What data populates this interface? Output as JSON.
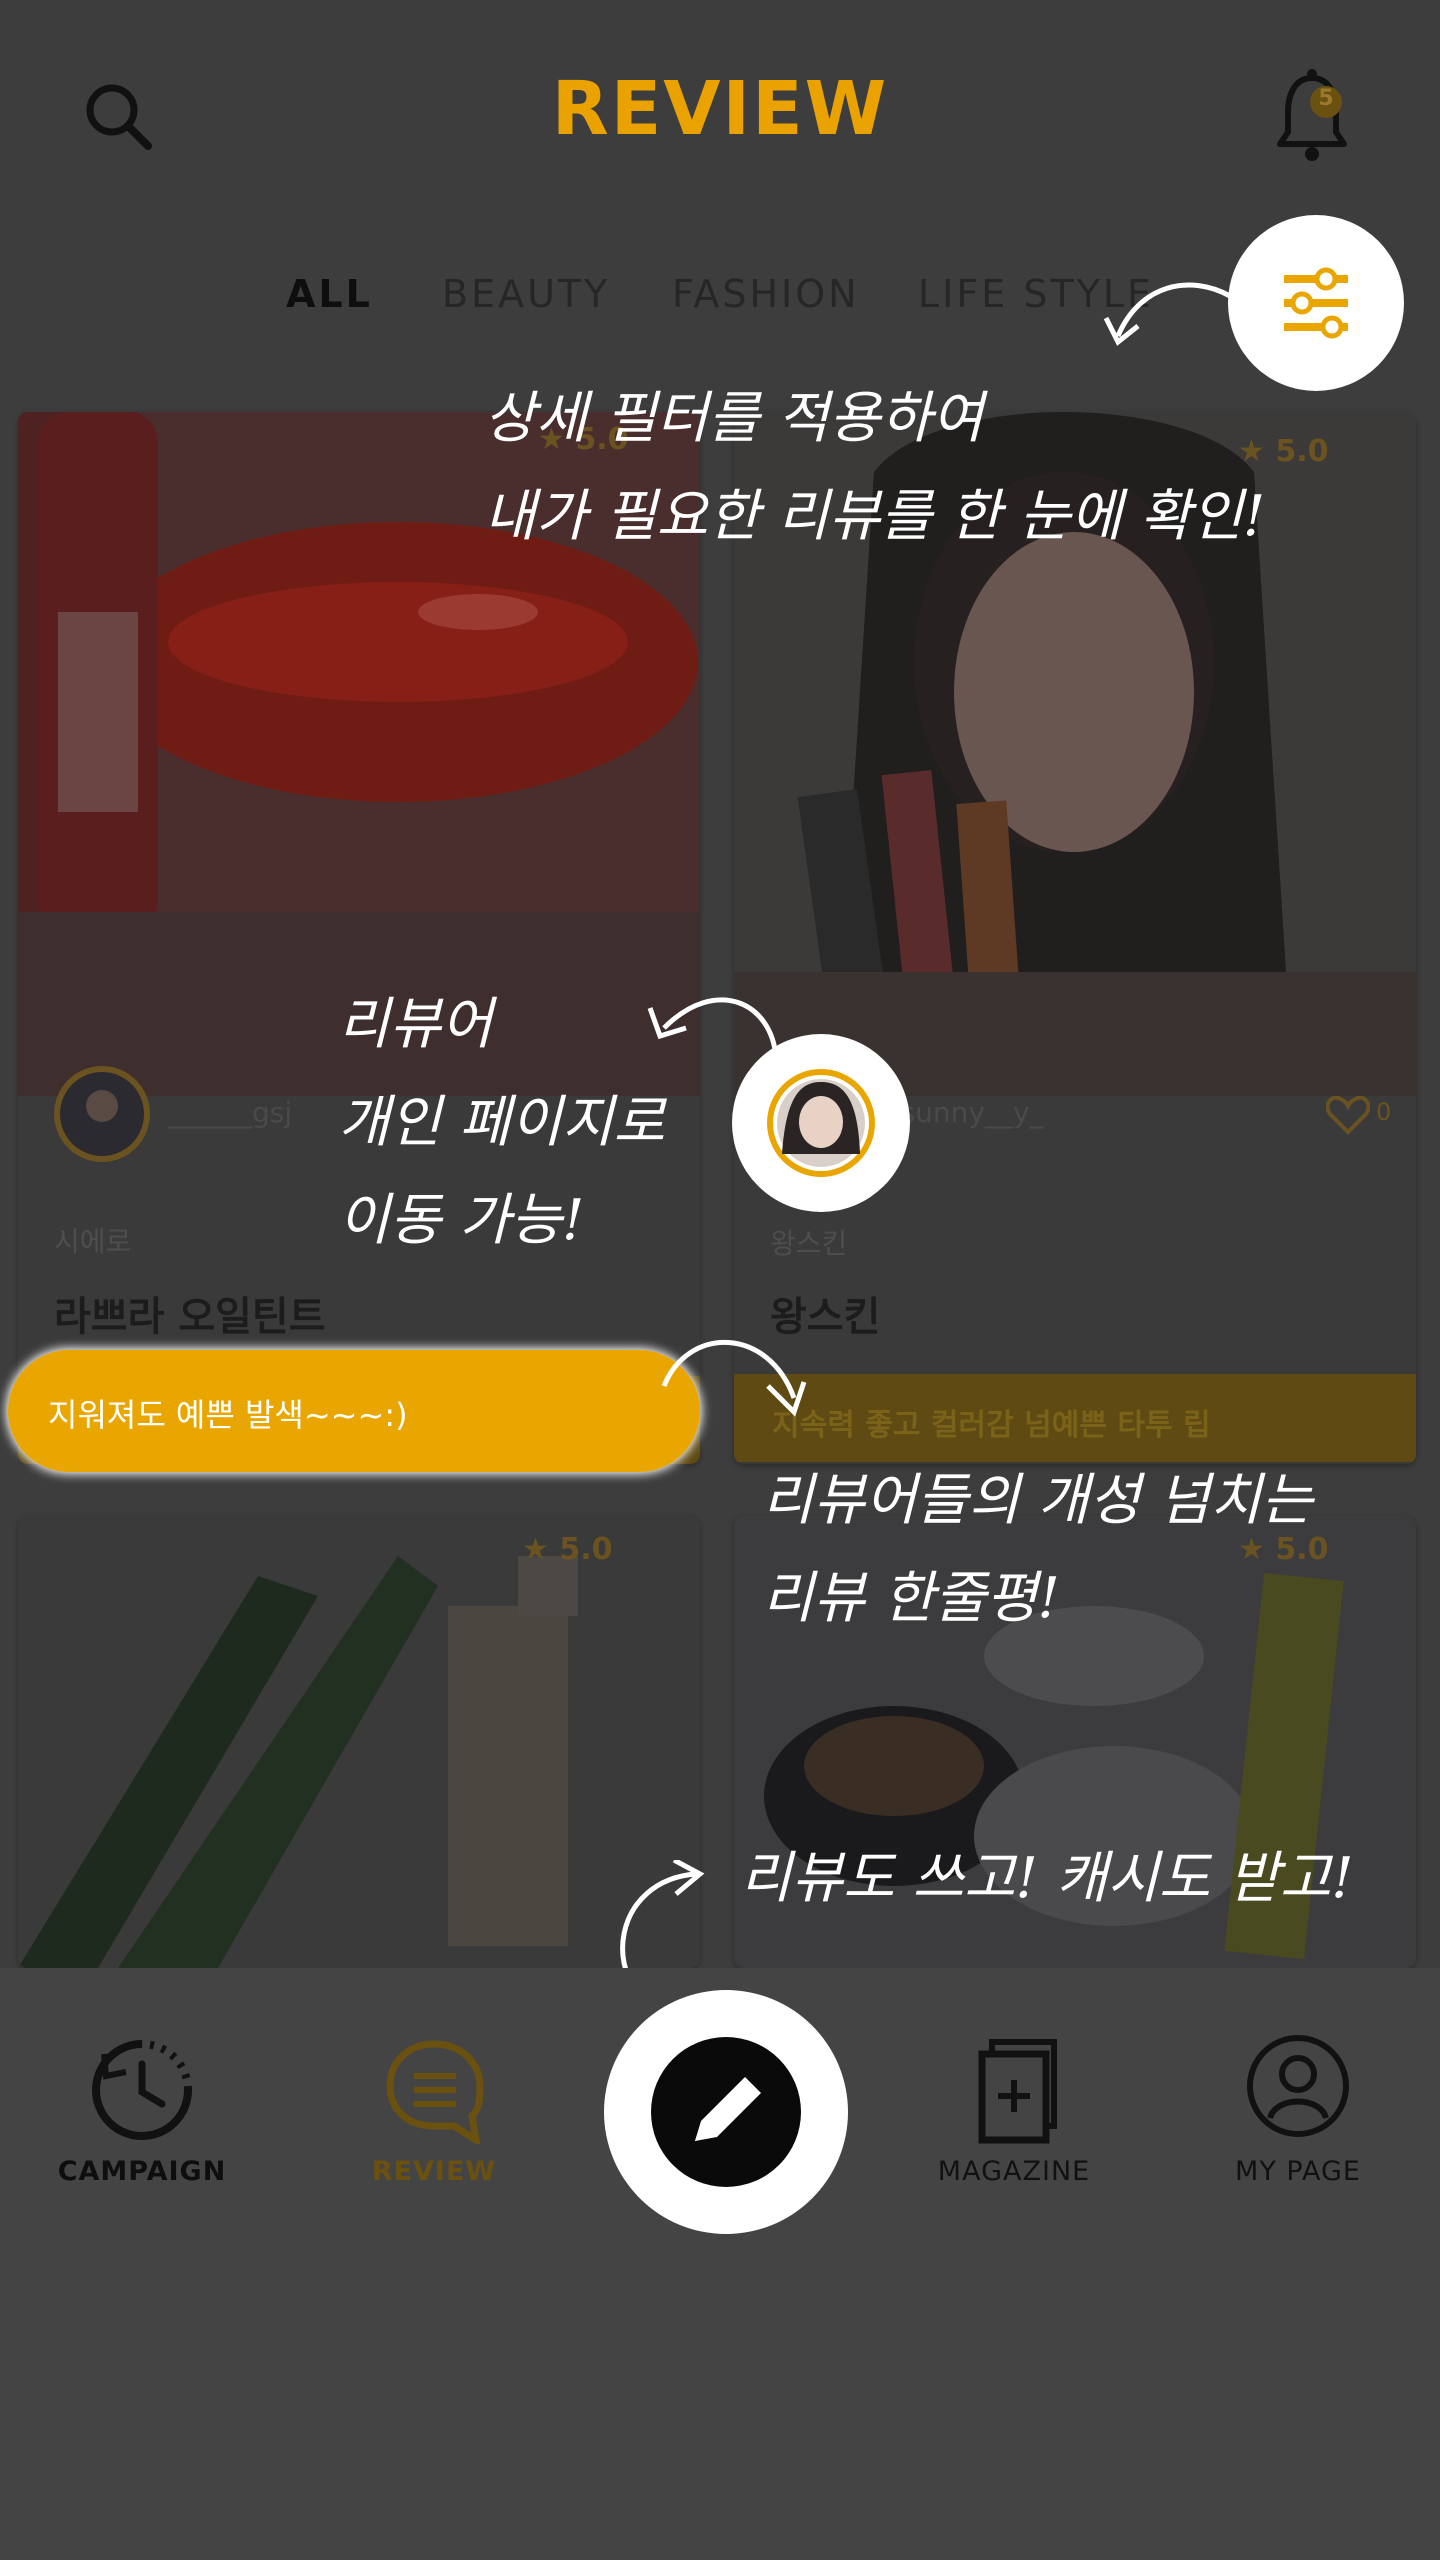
{
  "header": {
    "title": "REVIEW",
    "search_icon": "search-icon",
    "bell_icon": "bell-icon",
    "notification_count": "5"
  },
  "tabs": [
    {
      "label": "ALL",
      "active": true
    },
    {
      "label": "BEAUTY",
      "active": false
    },
    {
      "label": "FASHION",
      "active": false
    },
    {
      "label": "LIFE STYLE",
      "active": false
    }
  ],
  "cards": [
    {
      "rating": "★ 5.0",
      "user": "______gsj",
      "brand": "시에로",
      "product": "라쁘라 오일틴트",
      "comment": "지워져도 예쁜 발색~~~:)",
      "likes": ""
    },
    {
      "rating": "★ 5.0",
      "user": "ssunny__y_",
      "brand": "왕스킨",
      "product": "왕스킨",
      "comment": "지속력 좋고 컬러감 넘예쁜 타투 립",
      "likes": "0"
    },
    {
      "rating": "★ 5.0"
    },
    {
      "rating": "★ 5.0"
    }
  ],
  "guide": {
    "filter_note": "상세 필터를 적용하여\n내가 필요한 리뷰를 한 눈에 확인!",
    "reviewer_note": "리뷰어\n개인 페이지로\n이동 가능!",
    "comment_note": "리뷰어들의 개성 넘치는\n리뷰 한줄평!",
    "write_note": "리뷰도 쓰고! 캐시도 받고!",
    "comment_example": "지워져도 예쁜 발색~~~:)"
  },
  "bottom_nav": [
    {
      "label": "CAMPAIGN",
      "icon": "campaign-clock-icon"
    },
    {
      "label": "REVIEW",
      "icon": "review-chat-icon",
      "active": true
    },
    {
      "label": "",
      "icon": "write-pencil-icon"
    },
    {
      "label": "MAGAZINE",
      "icon": "magazine-add-icon"
    },
    {
      "label": "MY PAGE",
      "icon": "user-icon"
    }
  ],
  "colors": {
    "accent": "#eaa600",
    "overlay": "#3d3d3d",
    "white": "#ffffff"
  }
}
